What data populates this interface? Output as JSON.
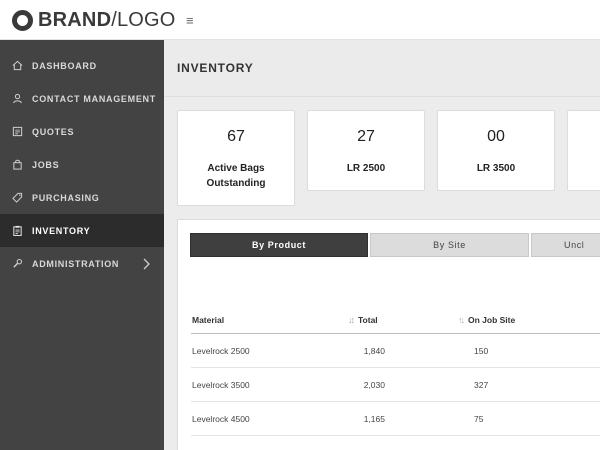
{
  "brand": {
    "bold": "BRAND",
    "rest": "/LOGO"
  },
  "header": {
    "menu_icon": "hamburger-icon",
    "menu_glyph": "≡"
  },
  "sidebar": {
    "items": [
      {
        "label": "DASHBOARD",
        "icon": "home-icon"
      },
      {
        "label": "CONTACT MANAGEMENT",
        "icon": "user-icon"
      },
      {
        "label": "QUOTES",
        "icon": "document-icon"
      },
      {
        "label": "JOBS",
        "icon": "bag-icon"
      },
      {
        "label": "PURCHASING",
        "icon": "tag-icon"
      },
      {
        "label": "INVENTORY",
        "icon": "clipboard-icon",
        "active": true
      },
      {
        "label": "ADMINISTRATION",
        "icon": "wrench-icon",
        "has_chevron": true
      }
    ]
  },
  "page": {
    "title": "INVENTORY"
  },
  "cards": [
    {
      "value": "67",
      "label_line1": "Active Bags",
      "label_line2": "Outstanding"
    },
    {
      "value": "27",
      "label_line1": "LR 2500"
    },
    {
      "value": "00",
      "label_line1": "LR 3500"
    }
  ],
  "tabs": [
    {
      "label": "By Product",
      "active": true
    },
    {
      "label": "By Site"
    },
    {
      "label": "Uncl"
    }
  ],
  "table": {
    "columns": {
      "material": "Material",
      "total": "Total",
      "on_job_site": "On Job Site"
    },
    "rows": [
      {
        "material": "Levelrock 2500",
        "total": "1,840",
        "on_job_site": "150"
      },
      {
        "material": "Levelrock 3500",
        "total": "2,030",
        "on_job_site": "327"
      },
      {
        "material": "Levelrock 4500",
        "total": "1,165",
        "on_job_site": "75"
      }
    ]
  },
  "colors": {
    "sidebar_bg": "#434343",
    "sidebar_active": "#2c2c2c",
    "tab_active": "#3f3f3f"
  }
}
